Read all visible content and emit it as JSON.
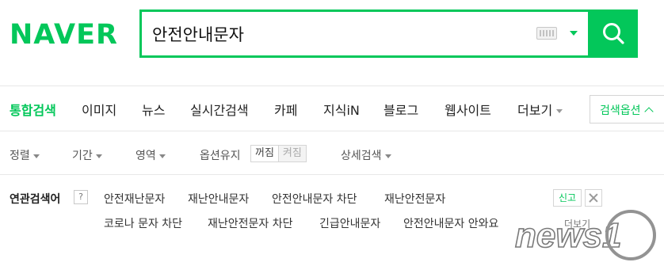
{
  "logo": "NAVER",
  "search": {
    "query": "안전안내문자"
  },
  "tabs": [
    {
      "label": "통합검색"
    },
    {
      "label": "이미지"
    },
    {
      "label": "뉴스"
    },
    {
      "label": "실시간검색"
    },
    {
      "label": "카페"
    },
    {
      "label": "지식iN"
    },
    {
      "label": "블로그"
    },
    {
      "label": "웹사이트"
    },
    {
      "label": "더보기"
    }
  ],
  "options_button": "검색옵션",
  "filters": {
    "sort": "정렬",
    "period": "기간",
    "area": "영역",
    "keep_options": "옵션유지",
    "toggle_off": "꺼짐",
    "toggle_on": "켜짐",
    "detail": "상세검색"
  },
  "related": {
    "title": "연관검색어",
    "help": "?",
    "items": [
      "안전재난문자",
      "재난안내문자",
      "안전안내문자 차단",
      "재난안전문자",
      "코로나 문자 차단",
      "재난안전문자 차단",
      "긴급안내문자",
      "안전안내문자 안와요"
    ],
    "report": "신고",
    "more": "더보기"
  },
  "watermark": "news1",
  "colors": {
    "brand": "#03c75a",
    "watermark": "#7a7a7a"
  }
}
